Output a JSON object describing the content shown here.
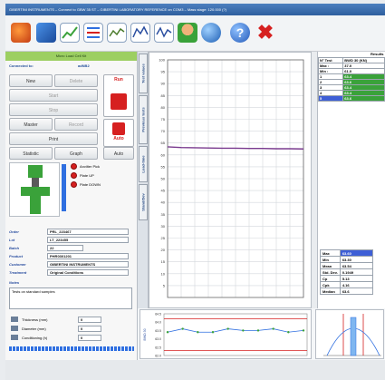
{
  "window": {
    "title": "GIBERTINI INSTRUMENTS – Connect to GBW 35 ST – GIBERTINI LABORATORY REFERENCE on COM3 – Mass stage: 120.000 (?)"
  },
  "toolbar": {
    "icons": [
      "instrument-icon",
      "connect-icon",
      "chart-icon",
      "list-icon",
      "trend-icon",
      "statistics-icon",
      "spc-icon",
      "user-icon",
      "globe-icon",
      "help-icon",
      "exit-icon"
    ]
  },
  "left": {
    "header": "Micro Load Cell Kit",
    "connected_label": "Connected to:",
    "connected_value": "adNB2",
    "buttons": {
      "new": "New",
      "delete": "Delete",
      "start": "Start",
      "stop": "Stop",
      "master": "Master",
      "record": "Record",
      "print": "Print",
      "statistic": "Statistic",
      "graph": "Graph",
      "run": "Run",
      "auto": "Auto",
      "auto_toggle": "Auto"
    },
    "legend": {
      "anvil": "Anvilter Pick",
      "plate_up": "Plate UP",
      "plate_down": "Plate DOWN"
    },
    "info": [
      {
        "label": "Order",
        "value": "PRL_223467"
      },
      {
        "label": "Lot",
        "value": "LT_223455"
      },
      {
        "label": "Batch",
        "value": "22"
      },
      {
        "label": "Product",
        "value": "PHR0301201"
      },
      {
        "label": "Customer",
        "value": "GIBERTINI INSTRUMENTS"
      },
      {
        "label": "Treatment",
        "value": "Original Conditions"
      }
    ],
    "notes_label": "Notes",
    "notes_value": "Tests on standard samples",
    "params": [
      {
        "label": "Thickness (mm)",
        "value": "0"
      },
      {
        "label": "Diameter (mm)",
        "value": "0"
      },
      {
        "label": "Conditioning (h)",
        "value": "0"
      }
    ]
  },
  "vtabs": [
    "Test values",
    "Previous tests",
    "Load-time",
    "Stand/Dev"
  ],
  "chart_data": {
    "type": "line",
    "x": [
      0,
      10,
      20,
      30,
      40,
      50,
      60,
      70,
      80,
      90,
      100
    ],
    "series": [
      {
        "values": [
          63.4,
          63.1,
          63.0,
          62.9,
          62.8,
          62.8,
          62.7,
          62.7,
          62.6,
          62.6,
          62.5
        ]
      }
    ],
    "yticks": [
      "100",
      "95",
      "90",
      "85",
      "80",
      "75",
      "70",
      "65",
      "60",
      "55",
      "50",
      "45",
      "40",
      "35",
      "30",
      "25",
      "20",
      "15",
      "10",
      "5"
    ],
    "ylim": [
      0,
      100
    ],
    "grid": true,
    "line_color": "#7a3b8f"
  },
  "results": {
    "header": "Results",
    "col_test": "N° Test",
    "col_value": "BWD 30 (KN)",
    "max_label": "Max :",
    "max_value": "37.0",
    "min_label": "Min :",
    "min_value": "61.0",
    "rows": [
      "63.4",
      "63.6",
      "63.4",
      "63.4",
      "63.6"
    ],
    "row_numbers": [
      "1",
      "2",
      "3",
      "4",
      "5"
    ]
  },
  "stats": [
    {
      "label": "Max",
      "value": "63.60"
    },
    {
      "label": "Min",
      "value": "63.30"
    },
    {
      "label": "Mean",
      "value": "63.54"
    },
    {
      "label": "Std. Dev.",
      "value": "0.1949"
    },
    {
      "label": "Cp",
      "value": "5.13"
    },
    {
      "label": "Cpk",
      "value": "4.16"
    },
    {
      "label": "Median",
      "value": "63.6"
    }
  ],
  "bottom_chart": {
    "ylabel": "BWD 30",
    "yticks": [
      "64.5",
      "64.0",
      "63.5",
      "63.0",
      "62.5",
      "62.0"
    ],
    "values": [
      63.4,
      63.6,
      63.4,
      63.4,
      63.6,
      63.5,
      63.5,
      63.6,
      63.4,
      63.5
    ]
  },
  "colors": {
    "accent": "#2f5f9e",
    "header_green": "#9ccf62",
    "result_green": "#3aa23a",
    "selected_row": "#3e5fd6",
    "led_red": "#d62020",
    "led_blue": "#2f6fe0"
  }
}
